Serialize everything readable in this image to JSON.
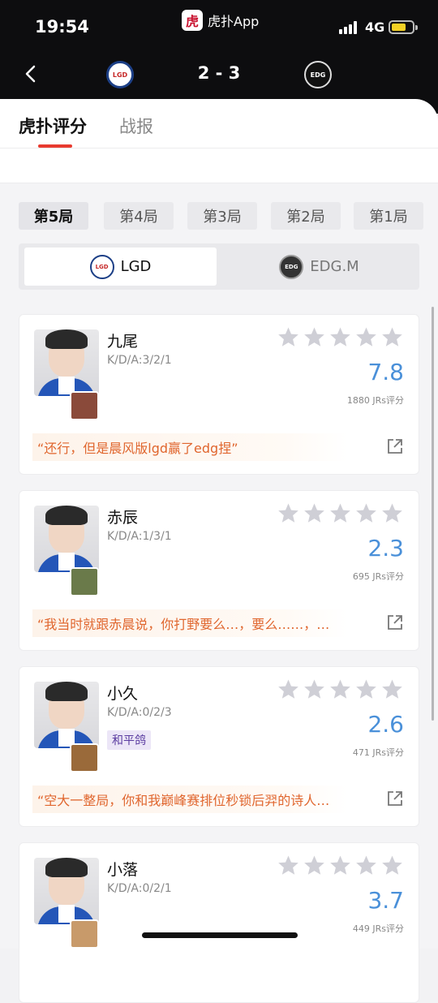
{
  "status_bar": {
    "time": "19:54",
    "app_name": "虎扑App",
    "network": "4G",
    "battery_color": "#f5d225"
  },
  "match": {
    "score": "2 - 3",
    "home_team": "LGD",
    "away_team": "EDG.M"
  },
  "tabs": [
    {
      "label": "虎扑评分"
    },
    {
      "label": "战报"
    }
  ],
  "game_tabs": [
    {
      "label": "第5局"
    },
    {
      "label": "第4局"
    },
    {
      "label": "第3局"
    },
    {
      "label": "第2局"
    },
    {
      "label": "第1局"
    }
  ],
  "team_switch": {
    "selected": "LGD",
    "other": "EDG.M"
  },
  "accent": {
    "tab_underline": "#e83a2f",
    "rating": "#4a90d9",
    "quote_text": "#e0662e",
    "star": "#cfcfd6"
  },
  "players": [
    {
      "name": "九尾",
      "kda": "K/D/A:3/2/1",
      "rating": "7.8",
      "votes": "1880 JRs评分",
      "quote": "“还行，但是晨风版lgd赢了edg捏”",
      "tag": ""
    },
    {
      "name": "赤辰",
      "kda": "K/D/A:1/3/1",
      "rating": "2.3",
      "votes": "695 JRs评分",
      "quote": "“我当时就跟赤晨说，你打野要么…，要么……，…",
      "tag": ""
    },
    {
      "name": "小久",
      "kda": "K/D/A:0/2/3",
      "rating": "2.6",
      "votes": "471 JRs评分",
      "quote": "“空大一整局，你和我巅峰赛排位秒锁后羿的诗人…",
      "tag": "和平鸽"
    },
    {
      "name": "小落",
      "kda": "K/D/A:0/2/1",
      "rating": "3.7",
      "votes": "449 JRs评分",
      "quote": "",
      "tag": ""
    }
  ]
}
